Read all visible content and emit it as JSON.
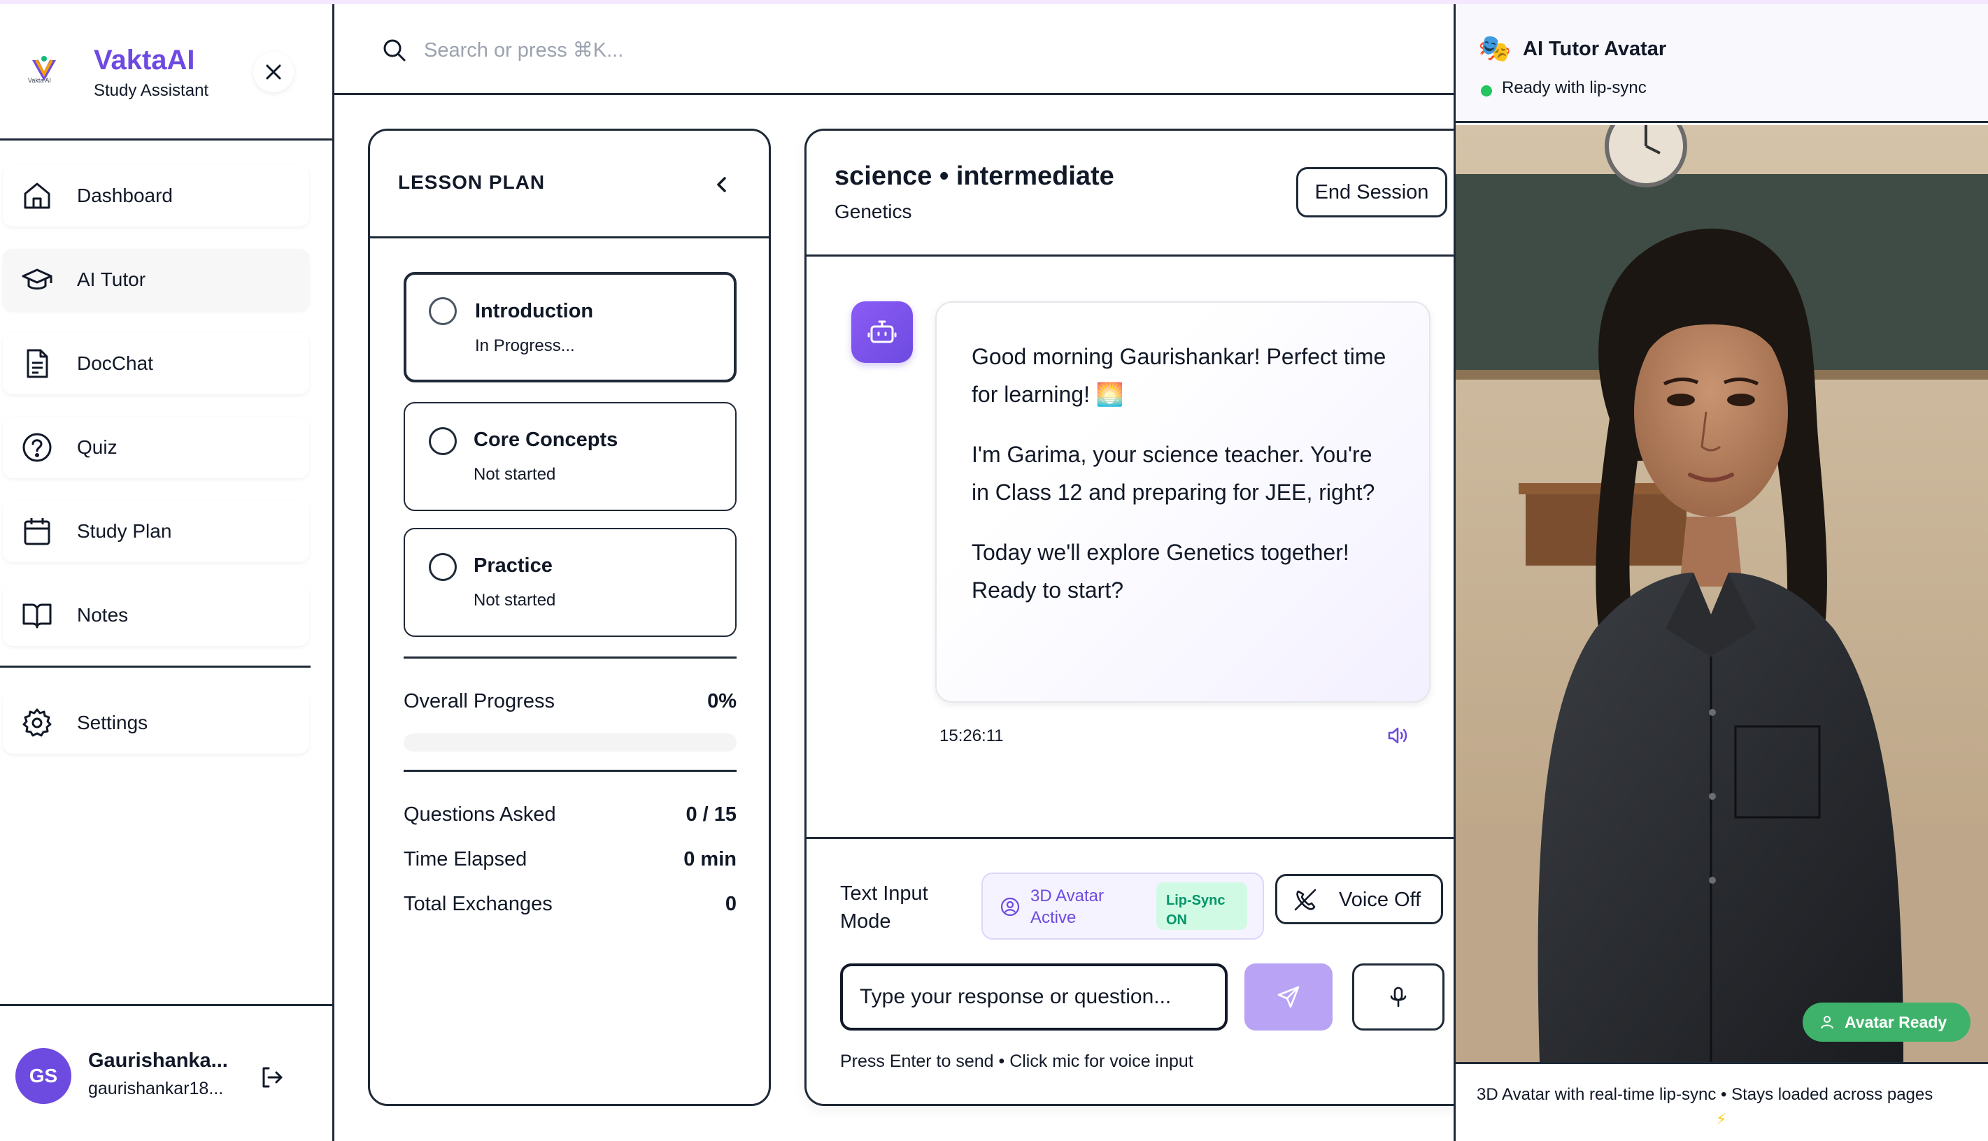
{
  "app": {
    "name": "VaktaAI",
    "subtitle": "Study Assistant",
    "logo_text": "Vakta AI"
  },
  "sidebar": {
    "items": [
      {
        "label": "Dashboard",
        "icon": "home-icon"
      },
      {
        "label": "AI Tutor",
        "icon": "graduation-cap-icon",
        "active": true
      },
      {
        "label": "DocChat",
        "icon": "document-icon"
      },
      {
        "label": "Quiz",
        "icon": "help-circle-icon"
      },
      {
        "label": "Study Plan",
        "icon": "calendar-icon"
      },
      {
        "label": "Notes",
        "icon": "book-open-icon"
      }
    ],
    "settings": {
      "label": "Settings",
      "icon": "gear-icon"
    }
  },
  "user": {
    "initials": "GS",
    "name": "Gaurishanka...",
    "email": "gaurishankar18..."
  },
  "search": {
    "placeholder": "Search or press ⌘K..."
  },
  "lesson_plan": {
    "title": "LESSON PLAN",
    "steps": [
      {
        "title": "Introduction",
        "status": "In Progress..."
      },
      {
        "title": "Core Concepts",
        "status": "Not started"
      },
      {
        "title": "Practice",
        "status": "Not started"
      }
    ],
    "progress": {
      "label": "Overall Progress",
      "value": "0%",
      "fraction": 0
    },
    "stats": [
      {
        "label": "Questions Asked",
        "value": "0 / 15"
      },
      {
        "label": "Time Elapsed",
        "value": "0 min"
      },
      {
        "label": "Total Exchanges",
        "value": "0"
      }
    ]
  },
  "chat": {
    "title": "science • intermediate",
    "topic": "Genetics",
    "end_label": "End Session",
    "message": {
      "paragraphs": [
        "Good morning Gaurishankar! Perfect time for learning! 🌅",
        "I'm Garima, your science teacher. You're in Class 12 and preparing for JEE, right?",
        "Today we'll explore Genetics together! Ready to start?"
      ],
      "time": "15:26:11"
    },
    "mode_label": "Text Input Mode",
    "avatar_status": "3D Avatar Active",
    "lipsync_badge": "Lip-Sync ON",
    "voice_label": "Voice Off",
    "input_placeholder": "Type your response or question...",
    "hint": "Press Enter to send • Click mic for voice input"
  },
  "avatar_panel": {
    "emoji": "🎭",
    "title": "AI Tutor Avatar",
    "status": "Ready with lip-sync",
    "ready_badge": "Avatar Ready",
    "footer": "3D Avatar with real-time lip-sync • Stays loaded across pages",
    "footer_icon": "⚡"
  },
  "colors": {
    "brand": "#6d4ae0",
    "border": "#1f2937",
    "success": "#3eb26a"
  }
}
